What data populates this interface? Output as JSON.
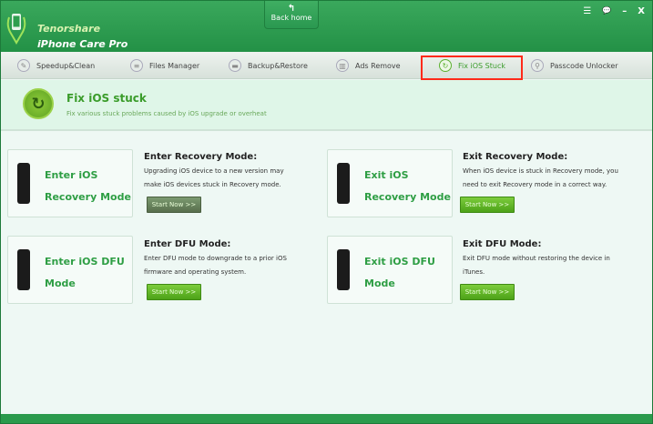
{
  "app": {
    "brand_line1": "Tenorshare",
    "brand_line2": "iPhone Care Pro",
    "back_home": "Back home"
  },
  "window_controls": [
    "☰",
    "💬",
    "–",
    "X"
  ],
  "tabs": [
    {
      "label": "Speedup&Clean",
      "icon": "rocket-icon",
      "glyph": "✎"
    },
    {
      "label": "Files Manager",
      "icon": "file-icon",
      "glyph": "≡"
    },
    {
      "label": "Backup&Restore",
      "icon": "folder-icon",
      "glyph": "▬"
    },
    {
      "label": "Ads Remove",
      "icon": "trash-icon",
      "glyph": "▥"
    },
    {
      "label": "Fix iOS Stuck",
      "icon": "refresh-icon",
      "glyph": "↻",
      "active": true
    },
    {
      "label": "Passcode Unlocker",
      "icon": "key-icon",
      "glyph": "⚲"
    }
  ],
  "banner": {
    "title": "Fix iOS stuck",
    "subtitle": "Fix various stuck problems caused by iOS upgrade or overheat"
  },
  "modes": [
    {
      "card_line1": "Enter iOS",
      "card_line2": "Recovery Mode",
      "heading": "Enter Recovery Mode:",
      "desc1": "Upgrading iOS device to a new version may",
      "desc2": "make iOS devices stuck in Recovery mode.",
      "button": "Start Now >>",
      "disabled": true
    },
    {
      "card_line1": "Exit iOS",
      "card_line2": "Recovery Mode",
      "heading": "Exit Recovery Mode:",
      "desc1": "When iOS device is stuck in Recovery mode, you",
      "desc2": "need to exit Recovery mode in a correct way.",
      "button": "Start Now >>"
    },
    {
      "card_line1": "Enter iOS DFU",
      "card_line2": "Mode",
      "heading": "Enter DFU Mode:",
      "desc1": "Enter DFU mode to downgrade to a prior iOS",
      "desc2": "firmware and operating system.",
      "button": "Start Now >>"
    },
    {
      "card_line1": "Exit iOS DFU",
      "card_line2": "Mode",
      "heading": "Exit DFU Mode:",
      "desc1": "Exit DFU mode without restoring the device in",
      "desc2": "iTunes.",
      "button": "Start Now >>"
    }
  ],
  "colors": {
    "header": "#239146",
    "accent": "#3a9c2a",
    "highlight": "#ff2a1a"
  }
}
